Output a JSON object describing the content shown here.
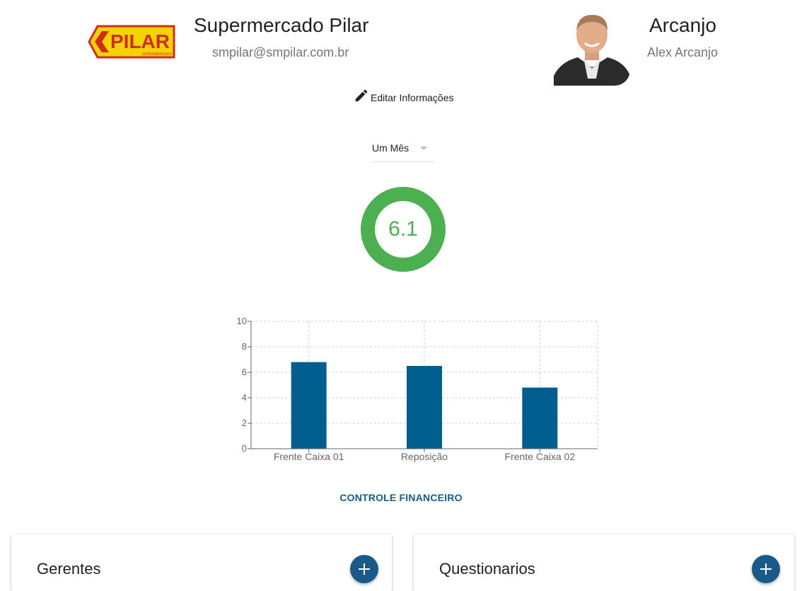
{
  "company": {
    "logo_text": "PILAR",
    "logo_subtext": "SUPERMERCADO",
    "name": "Supermercado Pilar",
    "email": "smpilar@smpilar.com.br"
  },
  "user": {
    "nickname": "Arcanjo",
    "full_name": "Alex Arcanjo"
  },
  "actions": {
    "edit_label": "Editar Informações",
    "financial_label": "CONTROLE FINANCEIRO"
  },
  "period": {
    "selected": "Um Mês"
  },
  "score": {
    "value": "6.1",
    "color": "#4caf50"
  },
  "chart_data": {
    "type": "bar",
    "categories": [
      "Frente Caixa 01",
      "Reposição",
      "Frente Caixa 02"
    ],
    "values": [
      6.8,
      6.5,
      4.8
    ],
    "ylim": [
      0,
      10
    ],
    "yticks": [
      0,
      2,
      4,
      6,
      8,
      10
    ],
    "grid": true,
    "bar_color": "#005e8f"
  },
  "cards": {
    "managers_title": "Gerentes",
    "quiz_title": "Questionarios"
  }
}
